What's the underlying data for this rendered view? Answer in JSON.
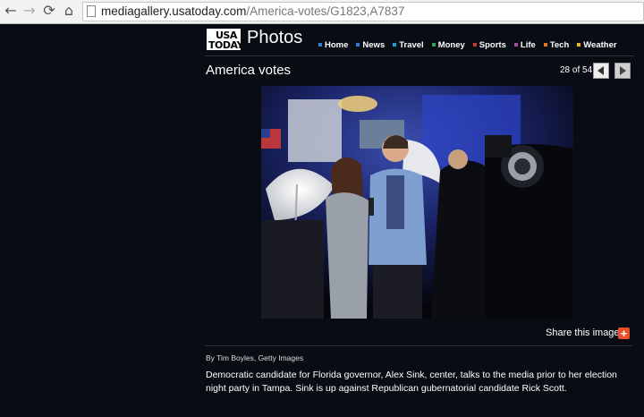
{
  "browser": {
    "url_host": "mediagallery.usatoday.com",
    "url_path": "/America-votes/G1823,A7837",
    "back_icon": "←",
    "forward_icon": "→",
    "reload_icon": "⟳",
    "home_icon": "⌂"
  },
  "header": {
    "logo_line1": "USA",
    "logo_line2": "TODAY",
    "title": "Photos",
    "nav": [
      {
        "label": "Home",
        "color": "#2b7fd4"
      },
      {
        "label": "News",
        "color": "#2b7fd4"
      },
      {
        "label": "Travel",
        "color": "#1f9fd8"
      },
      {
        "label": "Money",
        "color": "#2fa24a"
      },
      {
        "label": "Sports",
        "color": "#d9322b"
      },
      {
        "label": "Life",
        "color": "#a74aa6"
      },
      {
        "label": "Tech",
        "color": "#e87722"
      },
      {
        "label": "Weather",
        "color": "#f2b619"
      }
    ]
  },
  "gallery": {
    "title": "America votes",
    "counter": "28 of 54"
  },
  "share": {
    "label": "Share this image:",
    "button": "+"
  },
  "caption": {
    "credit": "By Tim Boyles, Getty Images",
    "text": "Democratic candidate for Florida governor, Alex Sink, center, talks to the media prior to her election night party in Tampa. Sink is up against Republican gubernatorial candidate Rick Scott."
  }
}
